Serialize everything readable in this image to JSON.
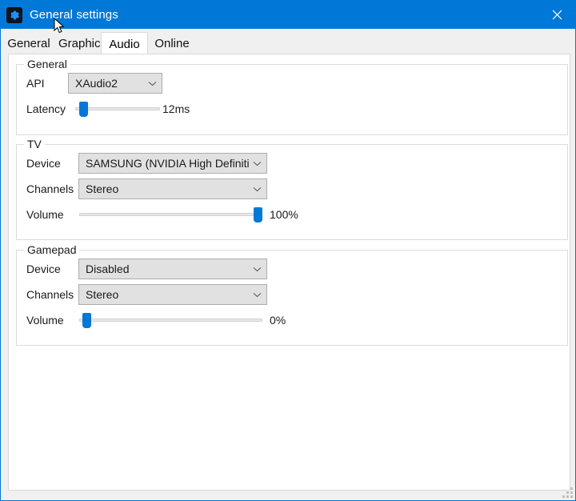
{
  "window": {
    "title": "General settings",
    "icon": "gear-icon",
    "close_label": "✕",
    "accent_color": "#0078d7"
  },
  "tabs": [
    {
      "label": "General",
      "selected": false
    },
    {
      "label": "Graphics",
      "selected": false
    },
    {
      "label": "Audio",
      "selected": true
    },
    {
      "label": "Online",
      "selected": false
    }
  ],
  "groups": {
    "general": {
      "label": "General",
      "api": {
        "label": "API",
        "value": "XAudio2"
      },
      "latency": {
        "label": "Latency",
        "value": "12ms",
        "percent": 8
      }
    },
    "tv": {
      "label": "TV",
      "device": {
        "label": "Device",
        "value": "SAMSUNG (NVIDIA High Definitic"
      },
      "channels": {
        "label": "Channels",
        "value": "Stereo"
      },
      "volume": {
        "label": "Volume",
        "value": "100%",
        "percent": 100
      }
    },
    "gamepad": {
      "label": "Gamepad",
      "device": {
        "label": "Device",
        "value": "Disabled"
      },
      "channels": {
        "label": "Channels",
        "value": "Stereo"
      },
      "volume": {
        "label": "Volume",
        "value": "0%",
        "percent": 0
      }
    }
  }
}
